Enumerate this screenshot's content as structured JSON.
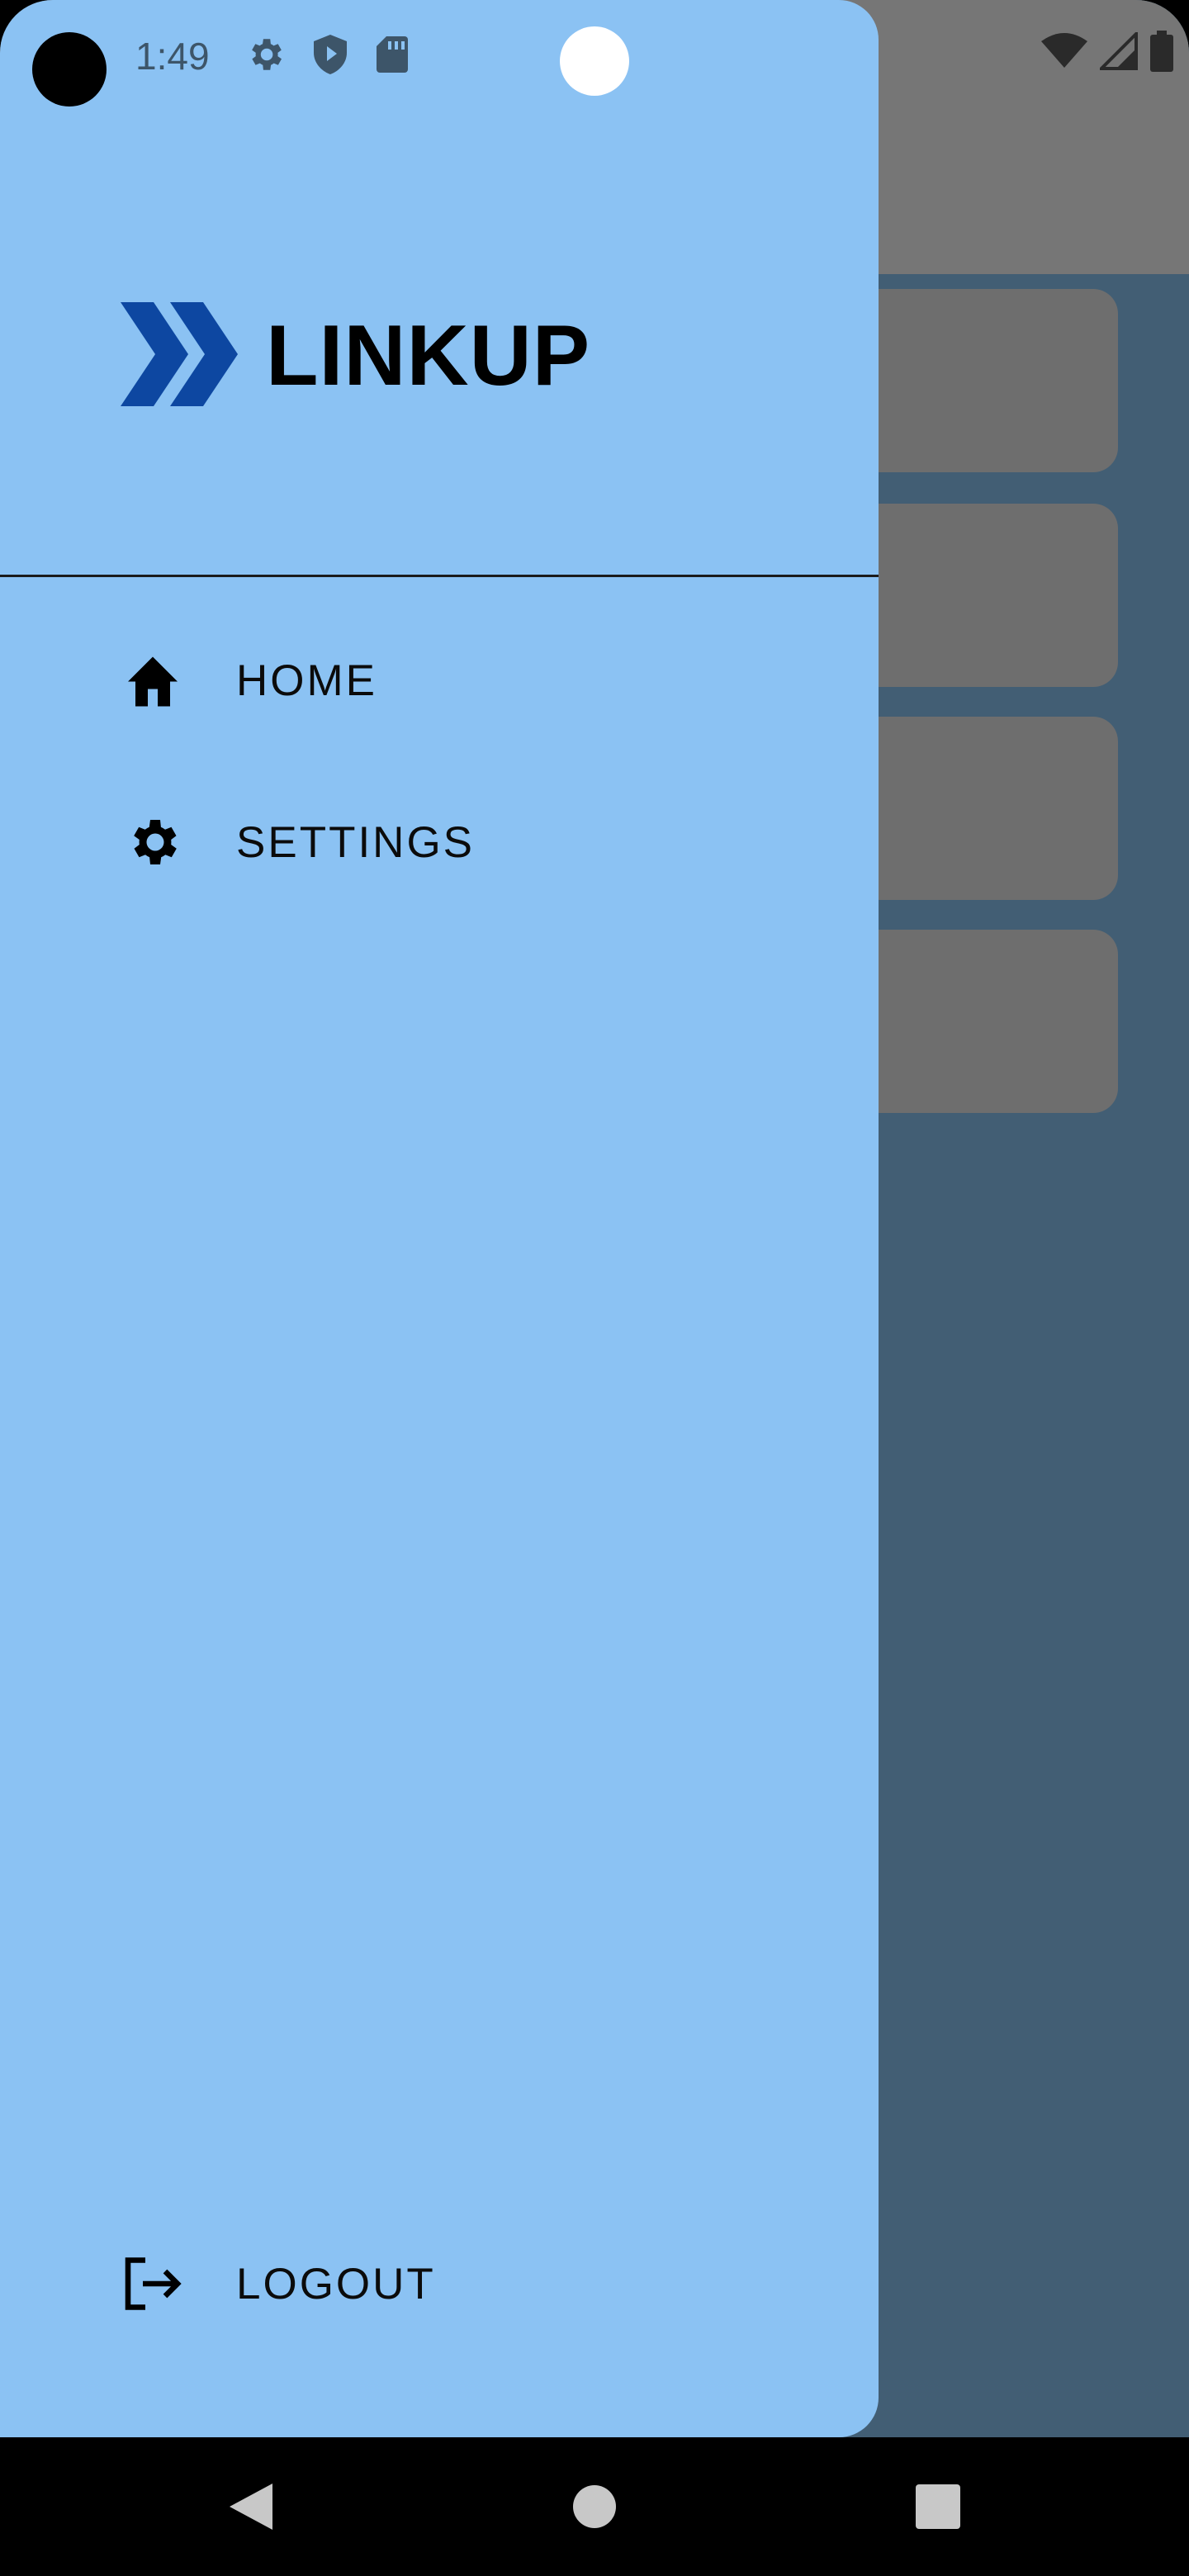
{
  "status_bar": {
    "time": "1:49",
    "left_icons": [
      "gear-icon",
      "shield-play-icon",
      "sd-card-icon"
    ],
    "right_icons": [
      "wifi-icon",
      "cell-signal-icon",
      "battery-icon"
    ]
  },
  "drawer": {
    "brand": {
      "logo_icon": "double-chevron-logo-icon",
      "name": "LINKUP",
      "logo_color": "#0d47a1"
    },
    "menu": [
      {
        "id": "home",
        "label": "HOME",
        "icon": "home-icon"
      },
      {
        "id": "settings",
        "label": "SETTINGS",
        "icon": "gear-icon"
      }
    ],
    "footer": {
      "logout_label": "LOGOUT",
      "logout_icon": "logout-icon"
    },
    "background_color": "#8bc2f3"
  },
  "background_app": {
    "scrim_color": "#425e74",
    "card_color": "#6e6e6e"
  },
  "nav_bar": {
    "buttons": [
      "back-icon",
      "home-circle-icon",
      "recent-apps-icon"
    ]
  }
}
